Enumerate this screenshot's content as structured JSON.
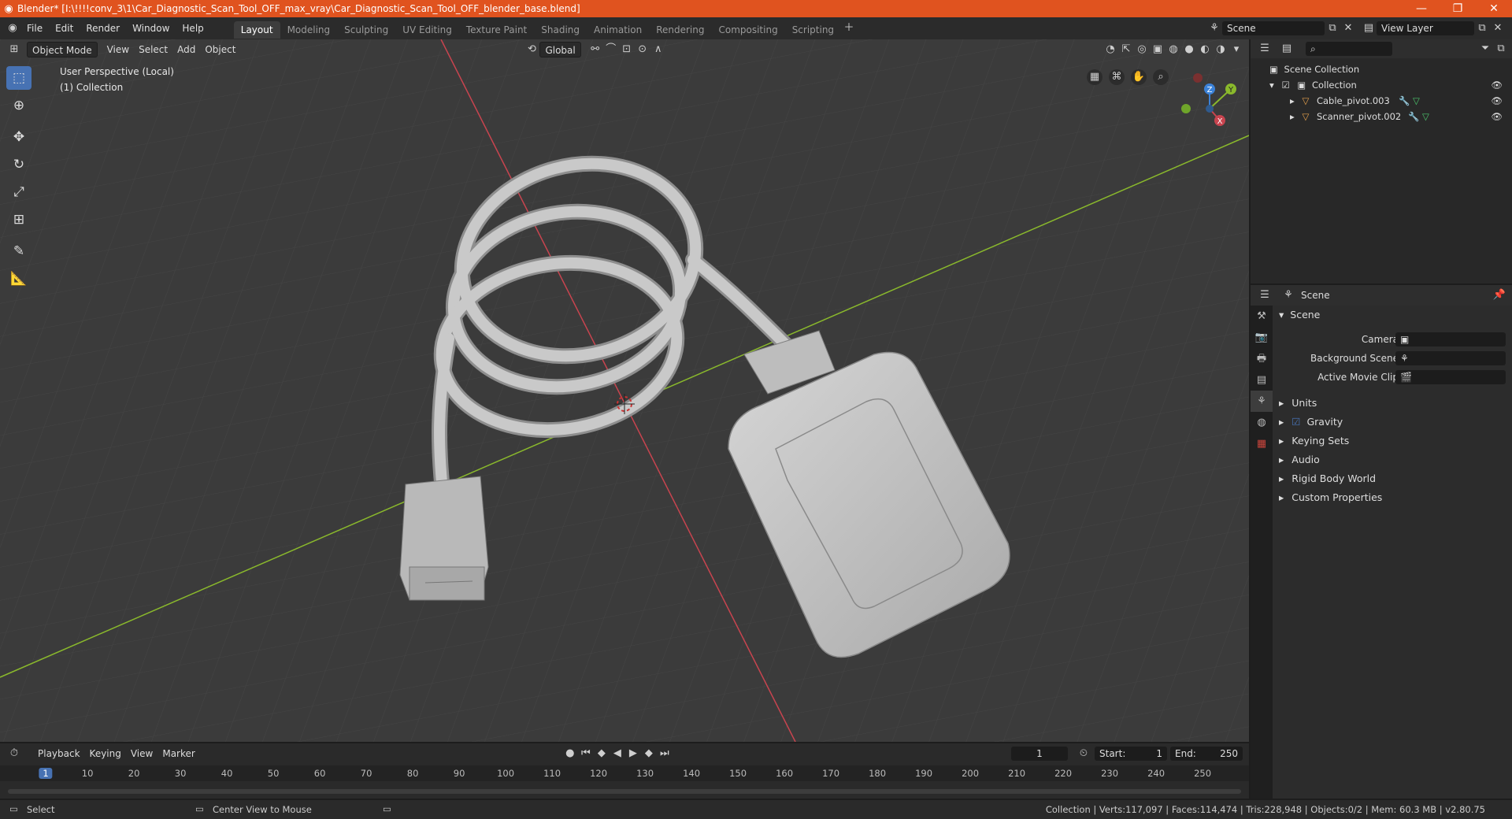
{
  "window": {
    "title": "Blender* [I:\\!!!!conv_3\\1\\Car_Diagnostic_Scan_Tool_OFF_max_vray\\Car_Diagnostic_Scan_Tool_OFF_blender_base.blend]",
    "minimize": "—",
    "maximize": "❐",
    "close": "✕"
  },
  "menu": [
    "File",
    "Edit",
    "Render",
    "Window",
    "Help"
  ],
  "workspaces": [
    "Layout",
    "Modeling",
    "Sculpting",
    "UV Editing",
    "Texture Paint",
    "Shading",
    "Animation",
    "Rendering",
    "Compositing",
    "Scripting"
  ],
  "active_workspace": "Layout",
  "scene_selector": "Scene",
  "view_layer": "View Layer",
  "viewport": {
    "mode": "Object Mode",
    "menus": [
      "View",
      "Select",
      "Add",
      "Object"
    ],
    "transform_orientation": "Global",
    "overlay_text_line1": "User Perspective (Local)",
    "overlay_text_line2": "(1) Collection",
    "axis_labels": {
      "z": "Z",
      "y": "Y",
      "x": "X"
    }
  },
  "outliner": {
    "root": "Scene Collection",
    "collection": "Collection",
    "items": [
      "Cable_pivot.003",
      "Scanner_pivot.002"
    ]
  },
  "properties": {
    "header": "Scene",
    "panel_title": "Scene",
    "fields": [
      {
        "label": "Camera"
      },
      {
        "label": "Background Scene"
      },
      {
        "label": "Active Movie Clip"
      }
    ],
    "panels": [
      "Units",
      "Gravity",
      "Keying Sets",
      "Audio",
      "Rigid Body World",
      "Custom Properties"
    ],
    "gravity_checked": true
  },
  "timeline": {
    "menus": [
      "Playback",
      "Keying",
      "View",
      "Marker"
    ],
    "current_frame": "1",
    "start_label": "Start:",
    "start": "1",
    "end_label": "End:",
    "end": "250",
    "ruler": [
      "1",
      "10",
      "20",
      "30",
      "40",
      "50",
      "60",
      "70",
      "80",
      "90",
      "100",
      "110",
      "120",
      "130",
      "140",
      "150",
      "160",
      "170",
      "180",
      "190",
      "200",
      "210",
      "220",
      "230",
      "240",
      "250"
    ]
  },
  "statusbar": {
    "left1": "Select",
    "left2": "Center View to Mouse",
    "right": "Collection | Verts:117,097 | Faces:114,474 | Tris:228,948 | Objects:0/2 | Mem: 60.3 MB | v2.80.75"
  },
  "colors": {
    "titlebar": "#e0531f",
    "accent": "#4772b3",
    "x_axis": "#c8444f",
    "y_axis": "#8ab92c",
    "z_axis": "#3b82d8"
  }
}
